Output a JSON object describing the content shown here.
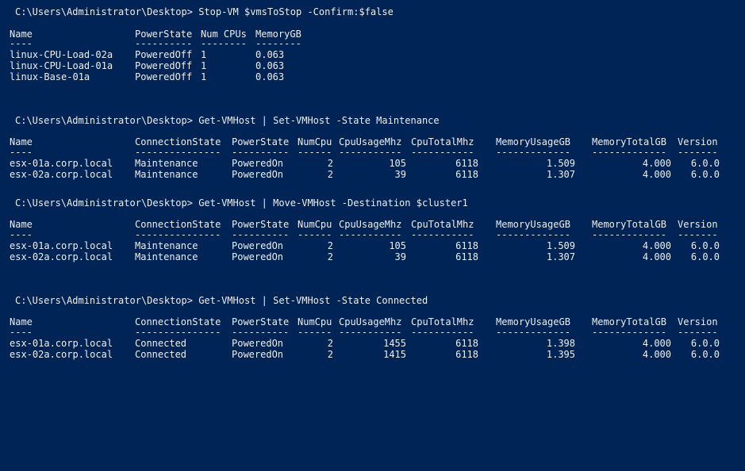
{
  "console": {
    "background": "#012456",
    "foreground": "#eeedf0",
    "blocks": [
      {
        "prompt": "C:\\Users\\Administrator\\Desktop> Stop-VM $vmsToStop -Confirm:$false",
        "headers": [
          "Name",
          "PowerState",
          "Num CPUs",
          "MemoryGB"
        ],
        "separators": [
          "----",
          "----------",
          "--------",
          "--------"
        ],
        "rows": [
          [
            "linux-CPU-Load-02a",
            "PoweredOff",
            "1",
            "0.063"
          ],
          [
            "linux-CPU-Load-01a",
            "PoweredOff",
            "1",
            "0.063"
          ],
          [
            "linux-Base-01a",
            "PoweredOff",
            "1",
            "0.063"
          ]
        ]
      },
      {
        "prompt": "C:\\Users\\Administrator\\Desktop> Get-VMHost | Set-VMHost -State Maintenance",
        "headers": [
          "Name",
          "ConnectionState",
          "PowerState",
          "NumCpu",
          "CpuUsageMhz",
          "CpuTotalMhz",
          "MemoryUsageGB",
          "MemoryTotalGB",
          "Version"
        ],
        "separators": [
          "----",
          "---------------",
          "----------",
          "------",
          "-----------",
          "-----------",
          "-------------",
          "-------------",
          "-------"
        ],
        "rows": [
          [
            "esx-01a.corp.local",
            "Maintenance",
            "PoweredOn",
            "2",
            "105",
            "6118",
            "1.509",
            "4.000",
            "6.0.0"
          ],
          [
            "esx-02a.corp.local",
            "Maintenance",
            "PoweredOn",
            "2",
            "39",
            "6118",
            "1.307",
            "4.000",
            "6.0.0"
          ]
        ]
      },
      {
        "prompt": "C:\\Users\\Administrator\\Desktop> Get-VMHost | Move-VMHost -Destination $cluster1",
        "headers": [
          "Name",
          "ConnectionState",
          "PowerState",
          "NumCpu",
          "CpuUsageMhz",
          "CpuTotalMhz",
          "MemoryUsageGB",
          "MemoryTotalGB",
          "Version"
        ],
        "separators": [
          "----",
          "---------------",
          "----------",
          "------",
          "-----------",
          "-----------",
          "-------------",
          "-------------",
          "-------"
        ],
        "rows": [
          [
            "esx-01a.corp.local",
            "Maintenance",
            "PoweredOn",
            "2",
            "105",
            "6118",
            "1.509",
            "4.000",
            "6.0.0"
          ],
          [
            "esx-02a.corp.local",
            "Maintenance",
            "PoweredOn",
            "2",
            "39",
            "6118",
            "1.307",
            "4.000",
            "6.0.0"
          ]
        ]
      },
      {
        "prompt": "C:\\Users\\Administrator\\Desktop> Get-VMHost | Set-VMHost -State Connected",
        "headers": [
          "Name",
          "ConnectionState",
          "PowerState",
          "NumCpu",
          "CpuUsageMhz",
          "CpuTotalMhz",
          "MemoryUsageGB",
          "MemoryTotalGB",
          "Version"
        ],
        "separators": [
          "----",
          "---------------",
          "----------",
          "------",
          "-----------",
          "-----------",
          "-------------",
          "-------------",
          "-------"
        ],
        "rows": [
          [
            "esx-01a.corp.local",
            "Connected",
            "PoweredOn",
            "2",
            "1455",
            "6118",
            "1.398",
            "4.000",
            "6.0.0"
          ],
          [
            "esx-02a.corp.local",
            "Connected",
            "PoweredOn",
            "2",
            "1415",
            "6118",
            "1.395",
            "4.000",
            "6.0.0"
          ]
        ]
      }
    ]
  }
}
